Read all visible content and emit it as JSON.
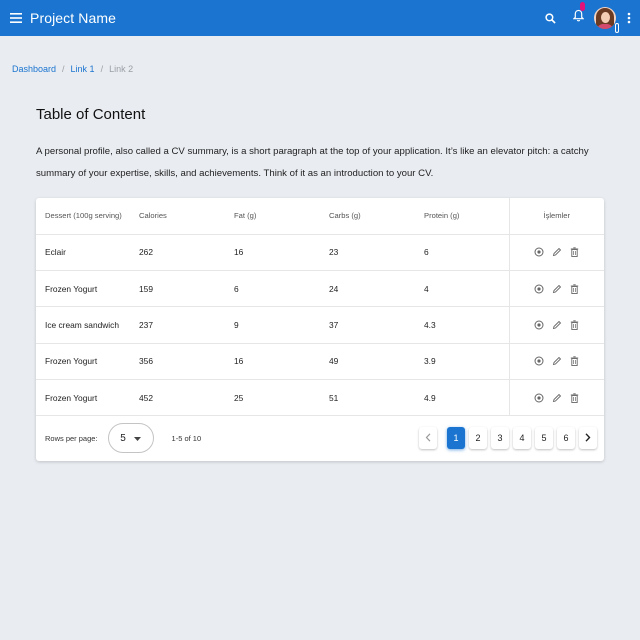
{
  "appbar": {
    "title": "Project Name",
    "icons": [
      "menu-icon",
      "search-icon",
      "bell-icon",
      "avatar",
      "more-vert-icon"
    ],
    "color": "#1b75d0",
    "notification_color": "#e2127a"
  },
  "breadcrumb": {
    "items": [
      {
        "label": "Dashboard"
      },
      {
        "label": "Link 1"
      },
      {
        "label": "Link 2"
      }
    ],
    "separator": "/"
  },
  "page": {
    "title": "Table of Content",
    "description": "A personal profile, also called a CV summary, is a short paragraph at the top of your application. It’s like an elevator pitch: a catchy summary of your expertise, skills, and achievements. Think of it as an introduction to your CV."
  },
  "table": {
    "headers": [
      "Dessert (100g serving)",
      "Calories",
      "Fat (g)",
      "Carbs (g)",
      "Protein (g)",
      "İşlemler"
    ],
    "rows": [
      [
        "Eclair",
        "262",
        "16",
        "23",
        "6"
      ],
      [
        "Frozen Yogurt",
        "159",
        "6",
        "24",
        "4"
      ],
      [
        "Ice cream sandwich",
        "237",
        "9",
        "37",
        "4.3"
      ],
      [
        "Frozen Yogurt",
        "356",
        "16",
        "49",
        "3.9"
      ],
      [
        "Frozen Yogurt",
        "452",
        "25",
        "51",
        "4.9"
      ]
    ],
    "row_action_icons": [
      "view-icon",
      "edit-icon",
      "delete-icon"
    ]
  },
  "pagination": {
    "rows_per_page_label": "Rows per page:",
    "rows_per_page_value": "5",
    "range_text": "1-5 of 10",
    "pages": [
      "1",
      "2",
      "3",
      "4",
      "5",
      "6"
    ],
    "current_page": "1",
    "prev_icon": "chevron-left-icon",
    "next_icon": "chevron-right-icon"
  }
}
